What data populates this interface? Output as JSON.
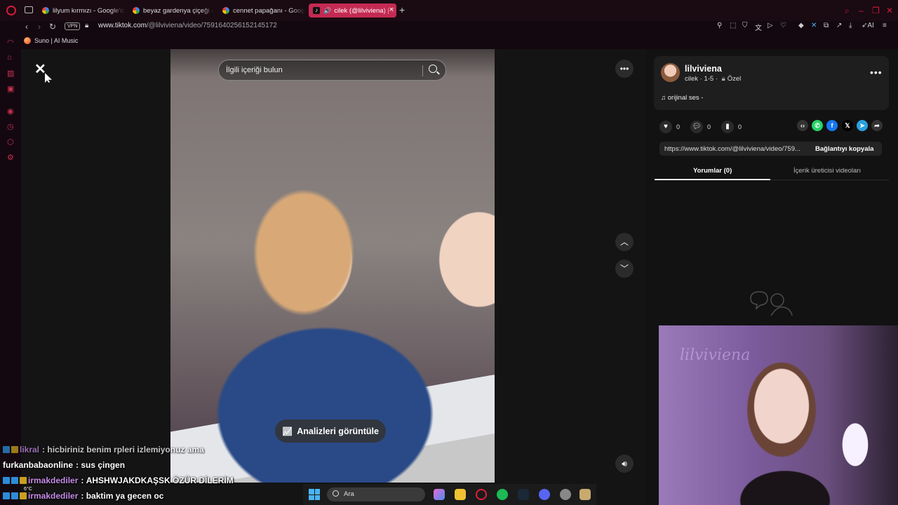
{
  "browser": {
    "tabs": [
      {
        "label": "lilyum kırmızı - Google'da",
        "active": false
      },
      {
        "label": "beyaz gardenya çiçeği - G",
        "active": false
      },
      {
        "label": "cennet papağanı - Google",
        "active": false
      },
      {
        "label": "cilek (@lilviviena) | Tik",
        "active": true
      }
    ],
    "vpn_label": "VPN",
    "url_domain": "www.tiktok.com",
    "url_path": "/@lilviviena/video/7591640256152145172",
    "bookmark": "Suno | AI Music",
    "ai_label": "AI"
  },
  "video": {
    "search_placeholder": "İlgili içeriği bulun",
    "analytics_label": "Analizleri görüntüle"
  },
  "author": {
    "username": "lilviviena",
    "nickname": "cilek",
    "age": "1-5",
    "privacy": "Özel",
    "sound": "orijinal ses -"
  },
  "stats": {
    "likes": "0",
    "comments": "0",
    "saves": "0"
  },
  "share": {
    "link": "https://www.tiktok.com/@lilviviena/video/759...",
    "copy_label": "Bağlantıyı kopyala"
  },
  "panel_tabs": {
    "comments": "Yorumlar (0)",
    "creator_videos": "İçerik üreticisi videoları"
  },
  "chat": [
    {
      "user": "likral",
      "message": "hicbiriniz benim rpleri izlemiyonuz ama",
      "color": "#c68de8"
    },
    {
      "user": "furkanbabaonline",
      "message": "sus çingen",
      "color": "#ffffff"
    },
    {
      "user": "irmakdediler",
      "message": "AHSHWJAKDKAŞSK ÖZÜR DİLERİM",
      "color": "#c68de8"
    },
    {
      "user": "irmakdediler",
      "message": "baktim ya gecen oc",
      "color": "#c68de8"
    }
  ],
  "taskbar": {
    "search_label": "Ara",
    "weather": "6°C"
  },
  "webcam": {
    "sign_text": "lilviviena"
  }
}
